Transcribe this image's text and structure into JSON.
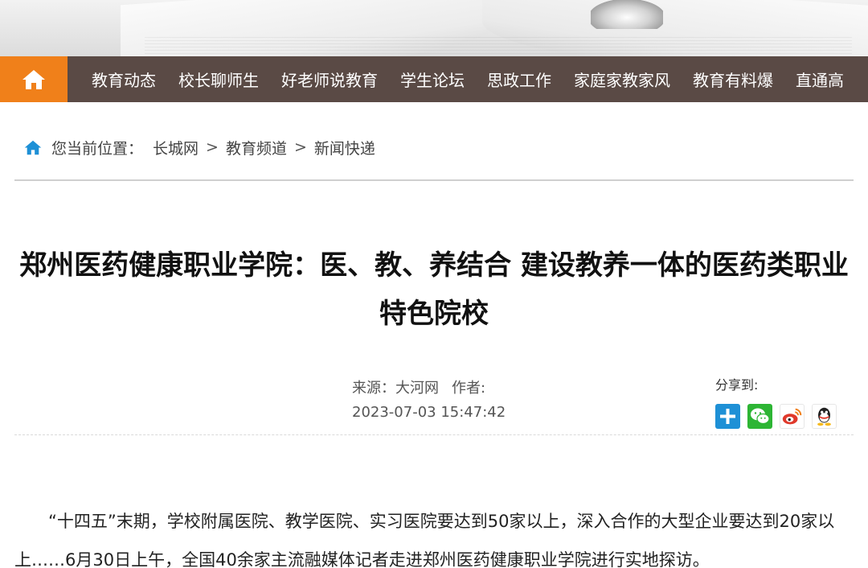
{
  "nav": {
    "home_icon": "home-icon",
    "items": [
      "教育动态",
      "校长聊师生",
      "好老师说教育",
      "学生论坛",
      "思政工作",
      "家庭家教家风",
      "教育有料爆",
      "直通高"
    ]
  },
  "breadcrumb": {
    "icon": "home-icon",
    "prefix": "您当前位置：",
    "links": [
      "长城网",
      "教育频道",
      "新闻快递"
    ],
    "separator": ">"
  },
  "article": {
    "title": "郑州医药健康职业学院：医、教、养结合 建设教养一体的医药类职业特色院校",
    "source_line": "来源：大河网",
    "author_line": "作者:",
    "datetime": "2023-07-03 15:47:42",
    "body": "“十四五”末期，学校附属医院、教学医院、实习医院要达到50家以上，深入合作的大型企业要达到20家以上……6月30日上午，全国40余家主流融媒体记者走进郑州医药健康职业学院进行实地探访。"
  },
  "share": {
    "label": "分享到:",
    "icons": [
      "plus-share-icon",
      "wechat-icon",
      "weibo-icon",
      "qq-icon"
    ]
  },
  "colors": {
    "nav_bg": "#5a4a45",
    "home_bg": "#f0801a",
    "accent_blue": "#1e90d6",
    "wechat_green": "#2db534",
    "weibo_red": "#e0392b"
  }
}
